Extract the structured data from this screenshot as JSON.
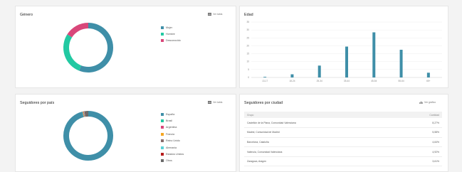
{
  "gender": {
    "title": "Género",
    "table_button": "Ver tabla",
    "legend": [
      {
        "label": "Mujer",
        "color": "#3f8fa8"
      },
      {
        "label": "Hombre",
        "color": "#22c9a2"
      },
      {
        "label": "Desconocido",
        "color": "#d9477a"
      }
    ],
    "chart_data": {
      "type": "pie",
      "labels": [
        "Mujer",
        "Hombre",
        "Desconocido"
      ],
      "values": [
        56,
        28,
        16
      ]
    }
  },
  "age": {
    "title": "Edad",
    "chart_data": {
      "type": "bar",
      "categories": [
        "13-17",
        "18-24",
        "25-34",
        "35-44",
        "45-54",
        "55-64",
        "65+"
      ],
      "values": [
        0.4,
        2,
        7.5,
        19.5,
        28.5,
        17.5,
        3
      ],
      "ylim": [
        0,
        35
      ],
      "yticks": [
        0,
        5,
        10,
        15,
        20,
        25,
        30,
        35
      ],
      "color": "#3f8fa8",
      "grid": true
    }
  },
  "country": {
    "title": "Seguidores por país",
    "table_button": "Ver tabla",
    "legend": [
      {
        "label": "España",
        "color": "#3f8fa8"
      },
      {
        "label": "Brasil",
        "color": "#22c9a2"
      },
      {
        "label": "Argentina",
        "color": "#d9477a"
      },
      {
        "label": "Francia",
        "color": "#f5a623"
      },
      {
        "label": "Reino Unido",
        "color": "#8a6d6d"
      },
      {
        "label": "Alemania",
        "color": "#5bd1d7"
      },
      {
        "label": "Estados Unidos",
        "color": "#b71c1c"
      },
      {
        "label": "Otros",
        "color": "#6b6b6b"
      }
    ],
    "chart_data": {
      "type": "pie",
      "labels": [
        "España",
        "Brasil",
        "Argentina",
        "Francia",
        "Reino Unido",
        "Alemania",
        "Estados Unidos",
        "Otros"
      ],
      "values": [
        96,
        0.3,
        0.3,
        0.3,
        0.3,
        0.3,
        0.3,
        2.2
      ]
    }
  },
  "city": {
    "title": "Seguidores por ciudad",
    "graph_button": "Ver gráfico",
    "headers": [
      "Grupo",
      "Cantidad"
    ],
    "rows": [
      [
        "Castellón de la Plana, Comunidad Valenciana",
        "8,27%"
      ],
      [
        "Madrid, Comunidad de Madrid",
        "5,58%"
      ],
      [
        "Barcelona, Cataluña",
        "4,64%"
      ],
      [
        "Valencia, Comunidad Valenciana",
        "4,92%"
      ],
      [
        "Zaragoza, Aragón",
        "3,61%"
      ]
    ]
  }
}
